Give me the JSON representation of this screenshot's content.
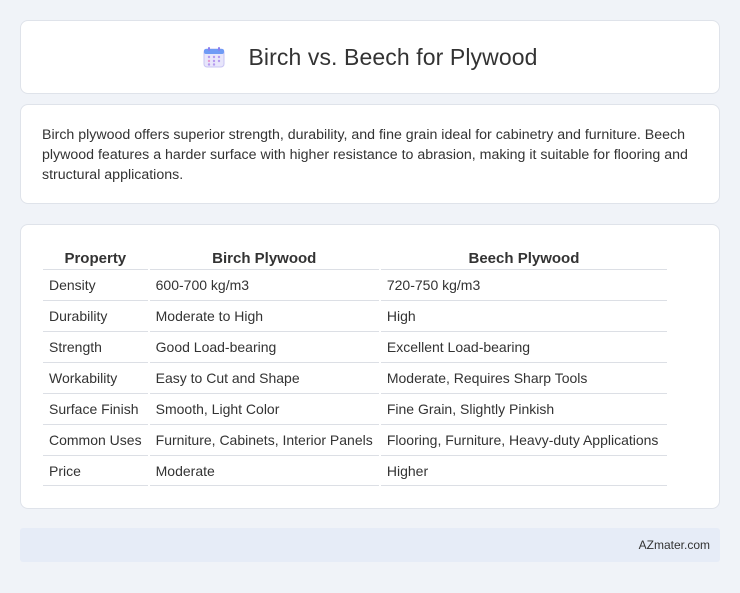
{
  "header": {
    "icon": "calendar-icon",
    "title": "Birch vs. Beech for Plywood"
  },
  "description": "Birch plywood offers superior strength, durability, and fine grain ideal for cabinetry and furniture. Beech plywood features a harder surface with higher resistance to abrasion, making it suitable for flooring and structural applications.",
  "table": {
    "headers": [
      "Property",
      "Birch Plywood",
      "Beech Plywood"
    ],
    "rows": [
      [
        "Density",
        "600-700 kg/m3",
        "720-750 kg/m3"
      ],
      [
        "Durability",
        "Moderate to High",
        "High"
      ],
      [
        "Strength",
        "Good Load-bearing",
        "Excellent Load-bearing"
      ],
      [
        "Workability",
        "Easy to Cut and Shape",
        "Moderate, Requires Sharp Tools"
      ],
      [
        "Surface Finish",
        "Smooth, Light Color",
        "Fine Grain, Slightly Pinkish"
      ],
      [
        "Common Uses",
        "Furniture, Cabinets, Interior Panels",
        "Flooring, Furniture, Heavy-duty Applications"
      ],
      [
        "Price",
        "Moderate",
        "Higher"
      ]
    ]
  },
  "footer": {
    "source": "AZmater.com"
  },
  "colors": {
    "background": "#f0f3f8",
    "card": "#ffffff",
    "footer_bg": "#e6ecf7",
    "icon_accent": "#7b8cf0"
  }
}
